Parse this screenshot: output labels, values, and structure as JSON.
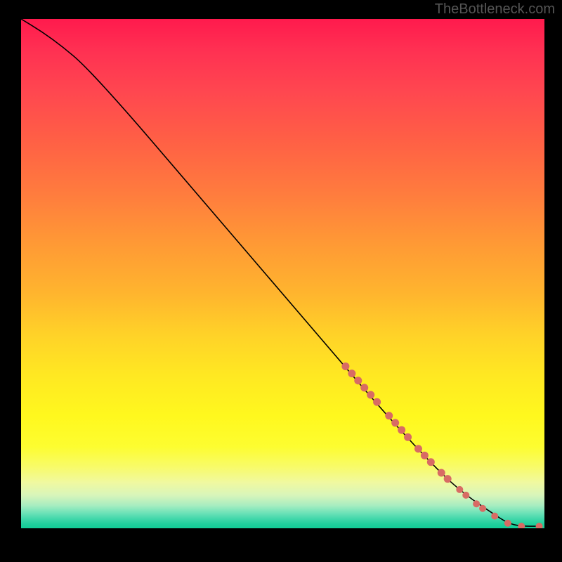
{
  "watermark": "TheBottleneck.com",
  "chart_data": {
    "type": "line",
    "title": "",
    "xlabel": "",
    "ylabel": "",
    "xlim": [
      0,
      100
    ],
    "ylim": [
      0,
      100
    ],
    "curve": [
      {
        "x": 0,
        "y": 100
      },
      {
        "x": 4,
        "y": 97.5
      },
      {
        "x": 8,
        "y": 94.5
      },
      {
        "x": 12,
        "y": 91
      },
      {
        "x": 20,
        "y": 82
      },
      {
        "x": 30,
        "y": 70
      },
      {
        "x": 40,
        "y": 58
      },
      {
        "x": 50,
        "y": 46
      },
      {
        "x": 60,
        "y": 34
      },
      {
        "x": 70,
        "y": 22
      },
      {
        "x": 80,
        "y": 11
      },
      {
        "x": 85,
        "y": 6.5
      },
      {
        "x": 90,
        "y": 3
      },
      {
        "x": 93,
        "y": 1
      },
      {
        "x": 95.5,
        "y": 0.4
      },
      {
        "x": 99,
        "y": 0.4
      }
    ],
    "points": [
      {
        "x": 62.0,
        "y": 31.8,
        "r": 5.5
      },
      {
        "x": 63.2,
        "y": 30.4,
        "r": 5.5
      },
      {
        "x": 64.4,
        "y": 29.0,
        "r": 5.5
      },
      {
        "x": 65.6,
        "y": 27.6,
        "r": 5.5
      },
      {
        "x": 66.8,
        "y": 26.2,
        "r": 5.5
      },
      {
        "x": 68.0,
        "y": 24.8,
        "r": 5.5
      },
      {
        "x": 70.3,
        "y": 22.1,
        "r": 5.5
      },
      {
        "x": 71.5,
        "y": 20.7,
        "r": 5.5
      },
      {
        "x": 72.7,
        "y": 19.3,
        "r": 5.5
      },
      {
        "x": 73.9,
        "y": 17.9,
        "r": 5.5
      },
      {
        "x": 75.9,
        "y": 15.6,
        "r": 5.5
      },
      {
        "x": 77.1,
        "y": 14.3,
        "r": 5.5
      },
      {
        "x": 78.3,
        "y": 13.0,
        "r": 5.5
      },
      {
        "x": 80.3,
        "y": 10.9,
        "r": 5.5
      },
      {
        "x": 81.5,
        "y": 9.7,
        "r": 5.5
      },
      {
        "x": 83.8,
        "y": 7.6,
        "r": 5.0
      },
      {
        "x": 85.0,
        "y": 6.5,
        "r": 5.0
      },
      {
        "x": 87.0,
        "y": 4.8,
        "r": 5.0
      },
      {
        "x": 88.2,
        "y": 3.9,
        "r": 5.0
      },
      {
        "x": 90.5,
        "y": 2.4,
        "r": 5.0
      },
      {
        "x": 93.0,
        "y": 1.0,
        "r": 5.0
      },
      {
        "x": 95.6,
        "y": 0.4,
        "r": 5.0
      },
      {
        "x": 99.0,
        "y": 0.4,
        "r": 5.0
      }
    ]
  }
}
